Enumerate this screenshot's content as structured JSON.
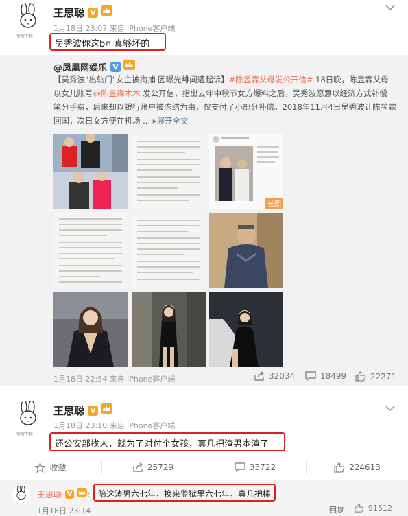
{
  "post1": {
    "username": "王思聪",
    "v_badge": "V",
    "meta": "1月18日 23:07 来自 iPhone客户端",
    "text": "吴秀波你这b可真够坏的"
  },
  "repost": {
    "source_user": "@凤凰网娱乐",
    "text_part1": "【吴秀波\"出轨门\"女主被拘捕 因曝光绯闻遭起诉】",
    "hashtag": "#陈昱霖父母发公开信#",
    "text_part2": " 18日晚，陈昱霖父母以女儿账号",
    "mention": "@陈昱霖木木",
    "text_part3": " 发公开信，指出去年中秋节女方爆料之后，吴秀波愿意以经济方式补偿一笔分手费，后来却以银行账户被冻结为由，仅支付了小部分补偿。2018年11月4日吴秀波让陈昱霖回国，次日女方便在机场 ...",
    "expand_label": "展开全文",
    "long_image_tag": "长图",
    "meta": "1月18日 22:54 来自 iPhone客户端",
    "reposts": "32034",
    "comments": "18499",
    "likes": "22271"
  },
  "post2": {
    "username": "王思聪",
    "v_badge": "V",
    "meta": "1月18日 23:10 来自 iPhone客户端",
    "text": "还公安部找人，就为了对付个女孩，真几把渣男本渣了",
    "favorite_label": "收藏",
    "reposts": "25729",
    "comments": "33722",
    "likes": "224613"
  },
  "comment": {
    "username": "王思聪",
    "v_badge": "V",
    "text": "陪这渣男六七年，换来监狱里六七年，真几把棒",
    "time": "1月18日 23:14",
    "reply_label": "回复",
    "likes": "91512"
  },
  "avatar_caption": "宝宝不醉",
  "colors": {
    "highlight_box": "#e02020",
    "link_orange": "#eb7350",
    "link_blue": "#507daf",
    "vip_gold": "#f6a623"
  }
}
